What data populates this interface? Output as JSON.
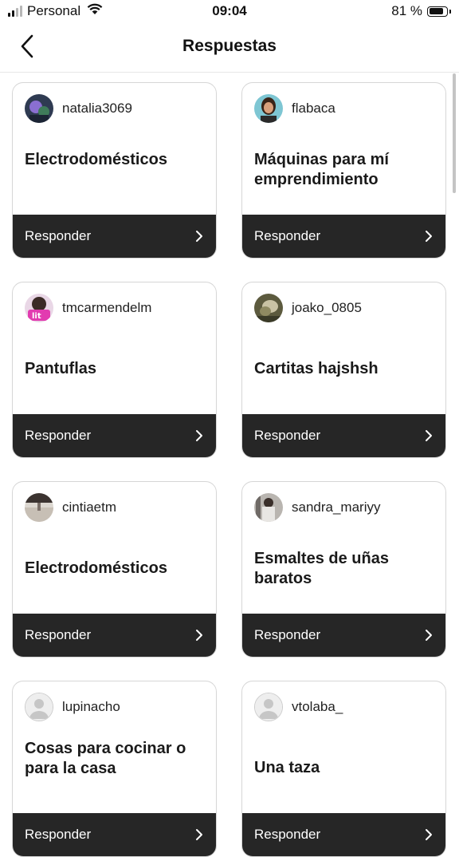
{
  "status_bar": {
    "carrier": "Personal",
    "time": "09:04",
    "battery": "81 %",
    "battery_level": 0.81
  },
  "header": {
    "title": "Respuestas"
  },
  "cards": [
    {
      "username": "natalia3069",
      "text": "Electrodomésticos",
      "button": "Responder",
      "avatar": "photo"
    },
    {
      "username": "flabaca",
      "text": "Máquinas para mí emprendimiento",
      "button": "Responder",
      "avatar": "photo"
    },
    {
      "username": "tmcarmendelm",
      "text": "Pantuflas",
      "button": "Responder",
      "avatar": "photo"
    },
    {
      "username": "joako_0805",
      "text": "Cartitas hajshsh",
      "button": "Responder",
      "avatar": "photo"
    },
    {
      "username": "cintiaetm",
      "text": "Electrodomésticos",
      "button": "Responder",
      "avatar": "photo"
    },
    {
      "username": "sandra_mariyy",
      "text": "Esmaltes de uñas baratos",
      "button": "Responder",
      "avatar": "photo"
    },
    {
      "username": "lupinacho",
      "text": "Cosas para cocinar o para la casa",
      "button": "Responder",
      "avatar": "default-avatar-icon"
    },
    {
      "username": "vtolaba_",
      "text": "Una taza",
      "button": "Responder",
      "avatar": "default-avatar-icon"
    }
  ]
}
